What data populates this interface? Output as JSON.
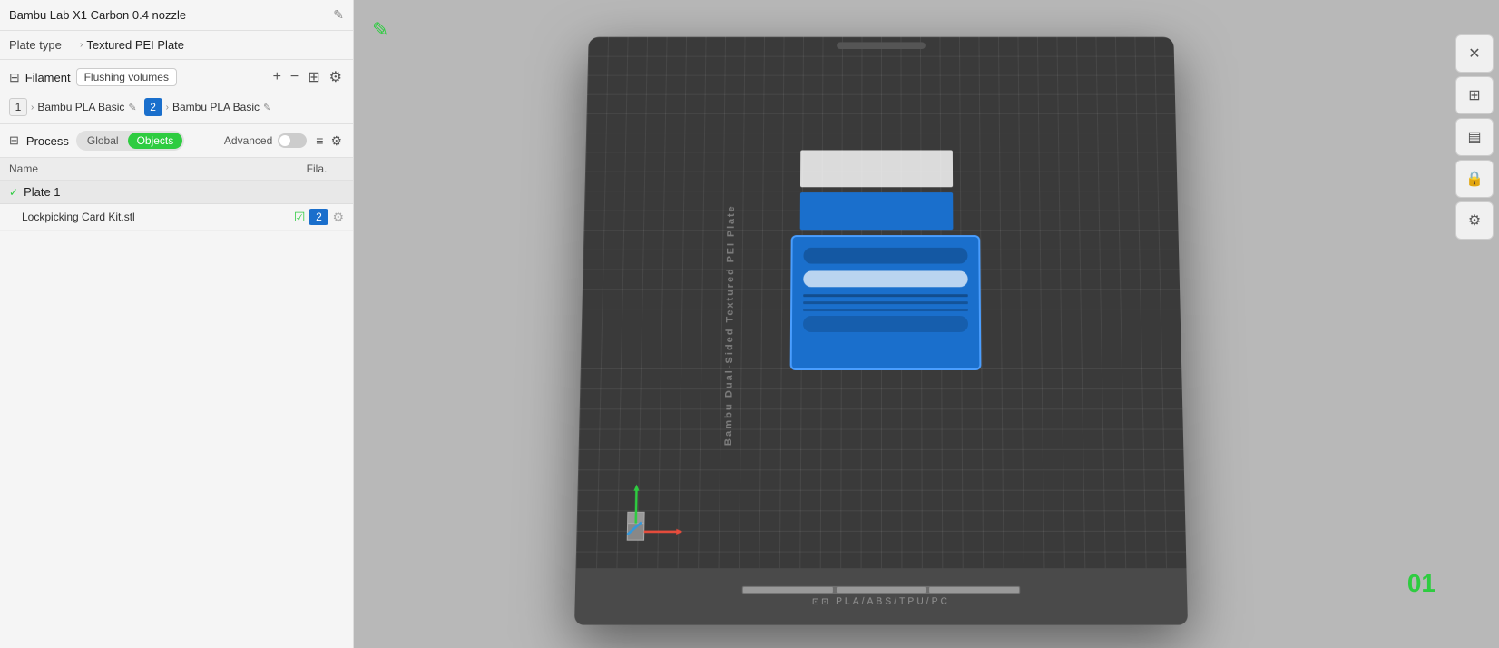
{
  "printer": {
    "name": "Bambu Lab X1 Carbon 0.4 nozzle",
    "edit_icon": "✎"
  },
  "plate_type": {
    "label": "Plate type",
    "arrow": "›",
    "value": "Textured PEI Plate"
  },
  "filament": {
    "section_title": "Filament",
    "flushing_btn": "Flushing volumes",
    "add_icon": "+",
    "remove_icon": "−",
    "slots": [
      {
        "number": "1",
        "type": "default",
        "name": "Bambu PLA Basic"
      },
      {
        "number": "2",
        "type": "blue",
        "name": "Bambu PLA Basic"
      }
    ]
  },
  "process": {
    "section_title": "Process",
    "tab_global": "Global",
    "tab_objects": "Objects",
    "advanced_label": "Advanced",
    "toggle_state": false
  },
  "object_list": {
    "col_name": "Name",
    "col_fila": "Fila.",
    "plate_name": "Plate 1",
    "objects": [
      {
        "name": "Lockpicking Card Kit.stl",
        "slot": "2",
        "checked": true
      }
    ]
  },
  "viewport": {
    "plate_label": "Bambu Dual-Sided Textured PEI Plate",
    "bottom_text": "PLA/ABS/TPU/PC",
    "plate_number": "01",
    "edit_icon": "✎"
  },
  "toolbar": {
    "buttons": [
      "✕",
      "⊞",
      "▤",
      "🔒",
      "⚙"
    ]
  }
}
